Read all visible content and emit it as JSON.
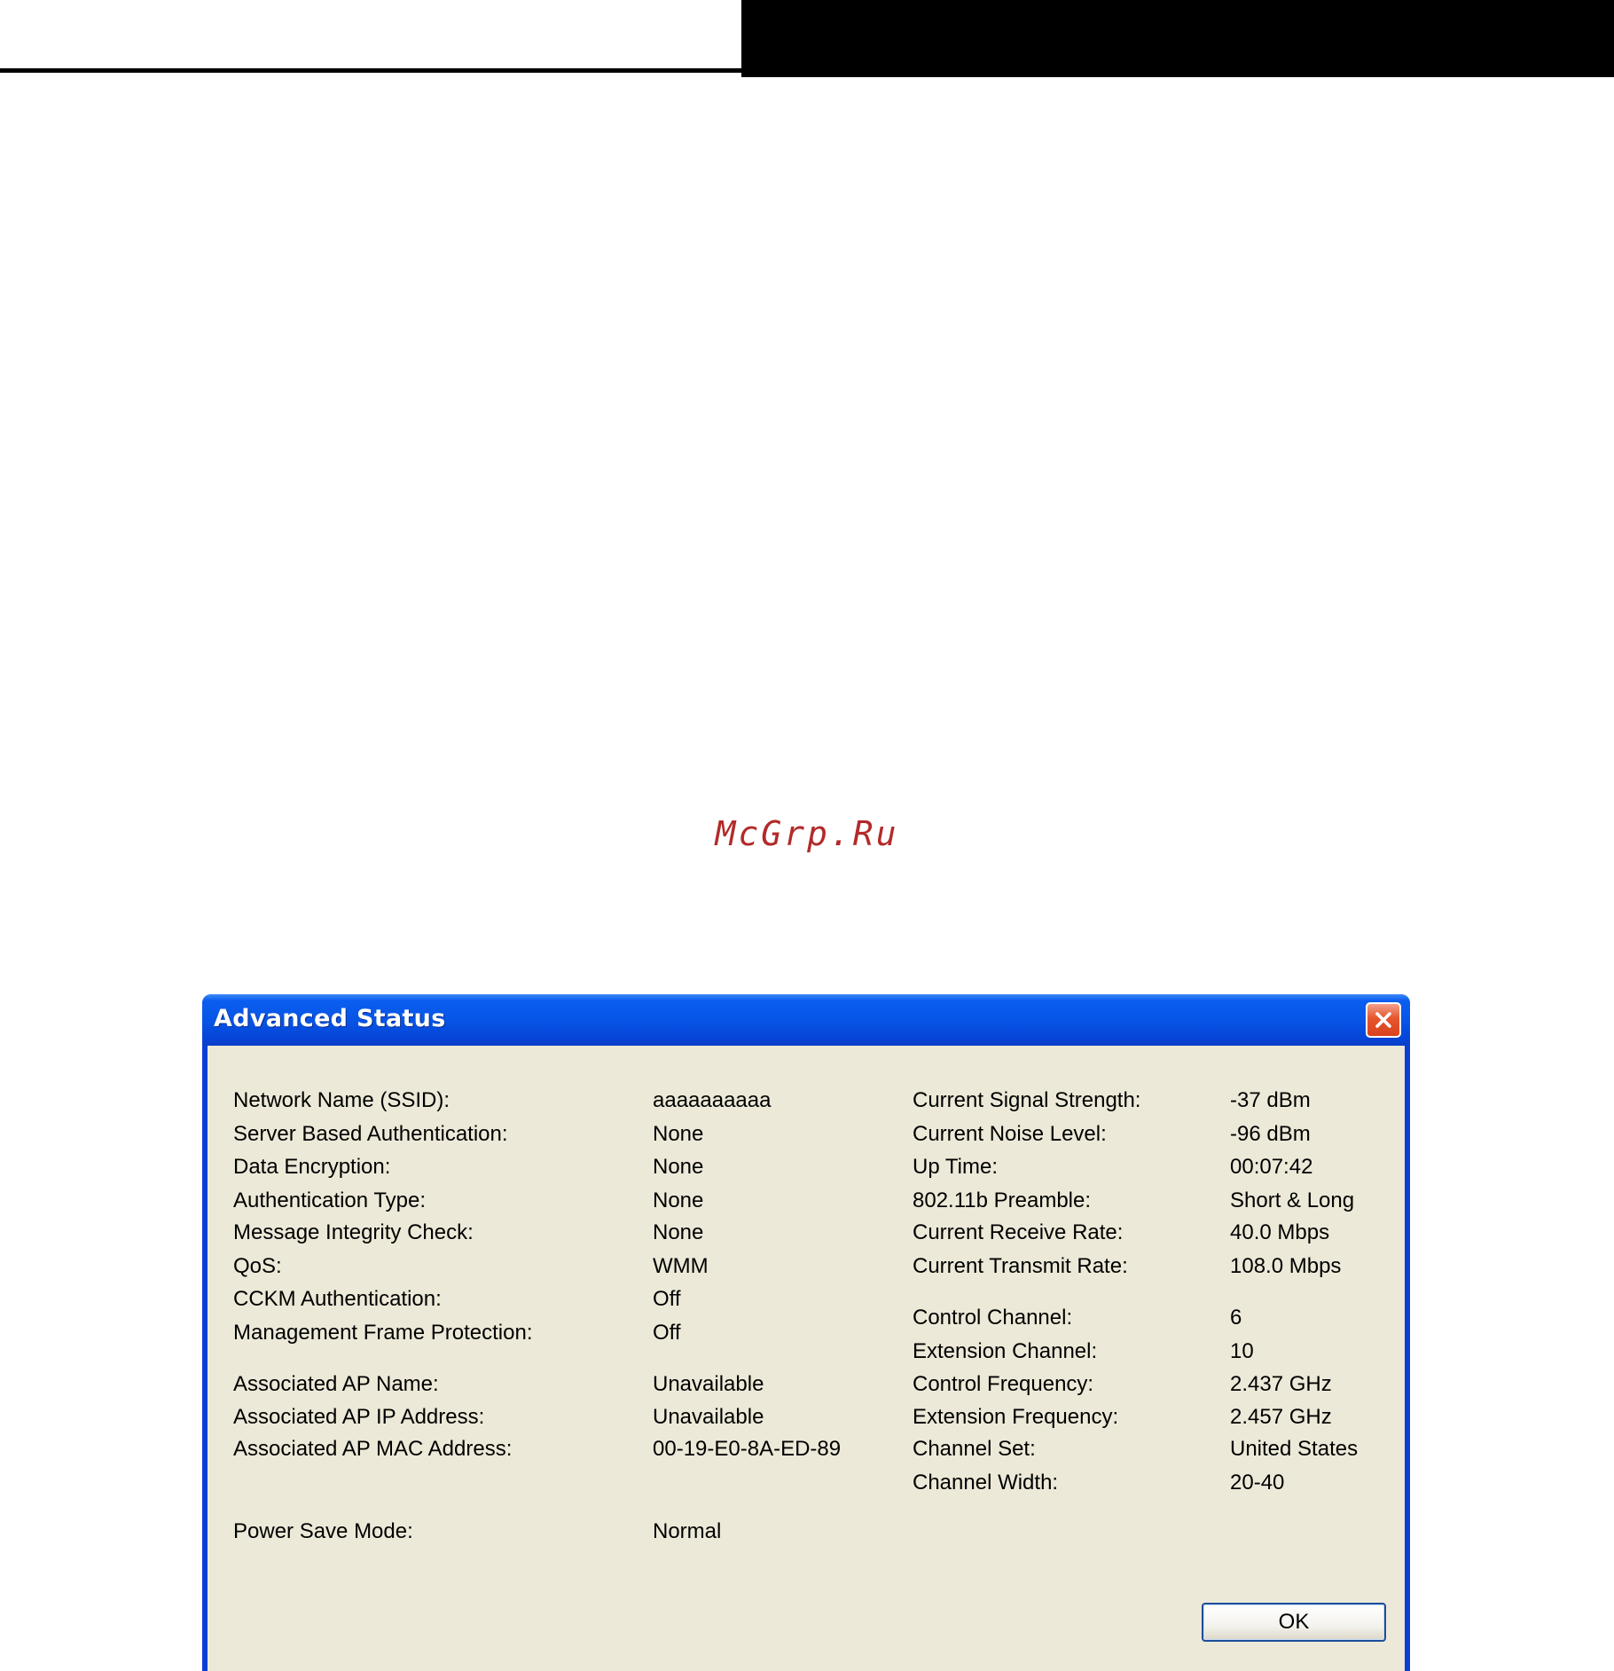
{
  "watermark": "McGrp.Ru",
  "dialog": {
    "title": "Advanced Status",
    "ok_label": "OK",
    "left_column": [
      {
        "label": "Network Name (SSID):",
        "value": "aaaaaaaaaa"
      },
      {
        "label": "Server Based Authentication:",
        "value": "None"
      },
      {
        "label": "Data Encryption:",
        "value": "None"
      },
      {
        "label": "Authentication Type:",
        "value": "None"
      },
      {
        "label": "Message Integrity Check:",
        "value": "None"
      },
      {
        "label": "QoS:",
        "value": "WMM"
      },
      {
        "label": "CCKM Authentication:",
        "value": "Off"
      },
      {
        "label": "Management Frame Protection:",
        "value": "Off"
      },
      {
        "label": "Associated AP Name:",
        "value": "Unavailable"
      },
      {
        "label": "Associated AP IP Address:",
        "value": "Unavailable"
      },
      {
        "label": "Associated AP MAC Address:",
        "value": "00-19-E0-8A-ED-89"
      },
      {
        "label": "Power Save Mode:",
        "value": "Normal"
      }
    ],
    "right_column": [
      {
        "label": "Current Signal Strength:",
        "value": "-37 dBm"
      },
      {
        "label": "Current Noise Level:",
        "value": "-96 dBm"
      },
      {
        "label": "Up Time:",
        "value": "00:07:42"
      },
      {
        "label": "802.11b Preamble:",
        "value": "Short & Long"
      },
      {
        "label": "Current Receive Rate:",
        "value": "40.0 Mbps"
      },
      {
        "label": "Current Transmit Rate:",
        "value": "108.0 Mbps"
      },
      {
        "label": "Control Channel:",
        "value": "6"
      },
      {
        "label": "Extension Channel:",
        "value": "10"
      },
      {
        "label": "Control Frequency:",
        "value": "2.437 GHz"
      },
      {
        "label": "Extension Frequency:",
        "value": "2.457 GHz"
      },
      {
        "label": "Channel Set:",
        "value": "United States"
      },
      {
        "label": "Channel Width:",
        "value": "20-40"
      }
    ]
  }
}
